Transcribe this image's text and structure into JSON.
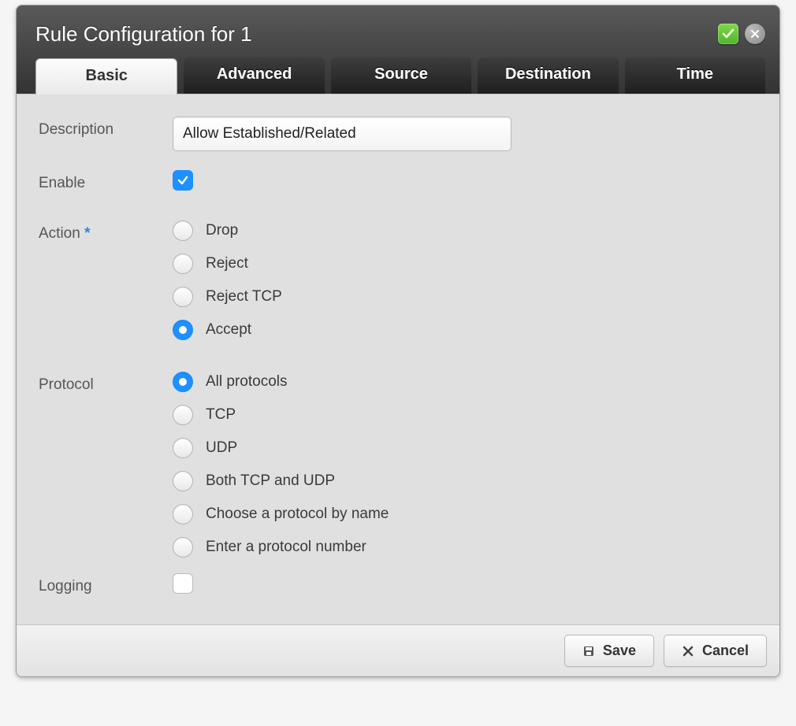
{
  "dialog": {
    "title": "Rule Configuration for 1"
  },
  "tabs": [
    "Basic",
    "Advanced",
    "Source",
    "Destination",
    "Time"
  ],
  "active_tab": "Basic",
  "form": {
    "description": {
      "label": "Description",
      "value": "Allow Established/Related"
    },
    "enable": {
      "label": "Enable",
      "checked": true
    },
    "action": {
      "label": "Action",
      "required_marker": "*",
      "options": [
        "Drop",
        "Reject",
        "Reject TCP",
        "Accept"
      ],
      "selected": "Accept"
    },
    "protocol": {
      "label": "Protocol",
      "options": [
        "All protocols",
        "TCP",
        "UDP",
        "Both TCP and UDP",
        "Choose a protocol by name",
        "Enter a protocol number"
      ],
      "selected": "All protocols"
    },
    "logging": {
      "label": "Logging",
      "checked": false
    }
  },
  "footer": {
    "save": "Save",
    "cancel": "Cancel"
  },
  "colors": {
    "accent": "#1e90ff",
    "confirm": "#5cc22e"
  }
}
